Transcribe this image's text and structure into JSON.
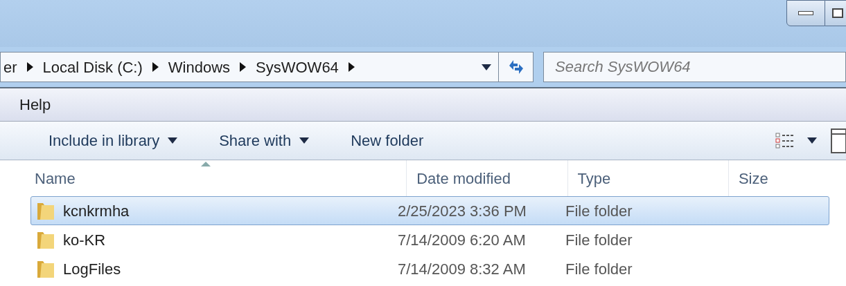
{
  "address_bar": {
    "breadcrumbs": [
      "er",
      "Local Disk (C:)",
      "Windows",
      "SysWOW64"
    ]
  },
  "search": {
    "placeholder": "Search SysWOW64"
  },
  "menu_bar": [
    "Help"
  ],
  "toolbar": [
    {
      "label": "Include in library",
      "dropdown": true
    },
    {
      "label": "Share with",
      "dropdown": true
    },
    {
      "label": "New folder",
      "dropdown": false
    }
  ],
  "table": {
    "columns": [
      "Name",
      "Date modified",
      "Type",
      "Size"
    ],
    "rows": [
      {
        "name": "kcnkrmha",
        "date": "2/25/2023 3:36 PM",
        "type": "File folder",
        "selected": true
      },
      {
        "name": "ko-KR",
        "date": "7/14/2009 6:20 AM",
        "type": "File folder",
        "selected": false
      },
      {
        "name": "LogFiles",
        "date": "7/14/2009 8:32 AM",
        "type": "File folder",
        "selected": false
      }
    ]
  }
}
